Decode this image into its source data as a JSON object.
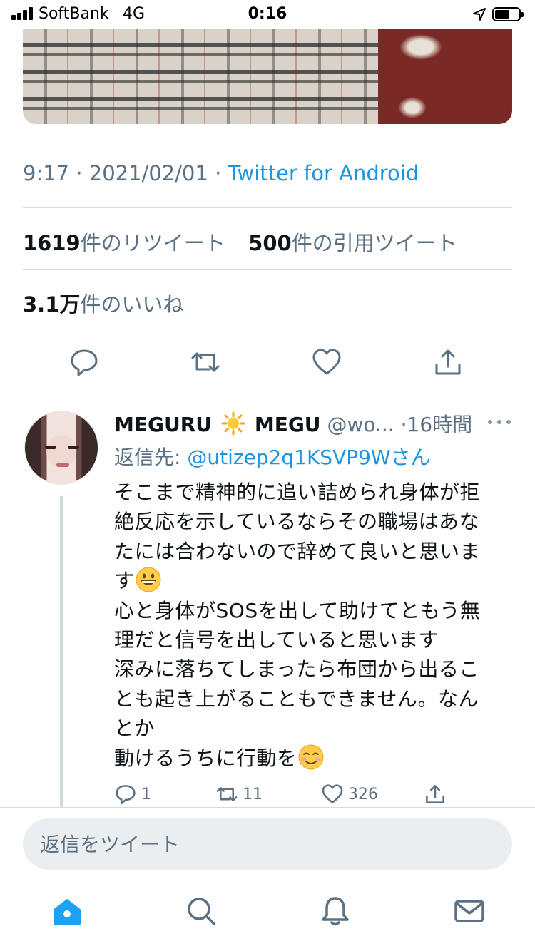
{
  "status_bar": {
    "carrier": "SoftBank",
    "network": "4G",
    "time": "0:16"
  },
  "tweet": {
    "image_icon": "photo-checkered-fabric",
    "time": "9:17",
    "separator": " · ",
    "date": "2021/02/01",
    "source": "Twitter for Android",
    "retweets_count": "1619",
    "retweets_label": "件のリツイート",
    "quotes_count": "500",
    "quotes_label": "件の引用ツイート",
    "likes_count": "3.1万",
    "likes_label": "件のいいね",
    "actions": [
      "reply-icon",
      "retweet-icon",
      "like-icon",
      "share-icon"
    ]
  },
  "reply": {
    "name_part1": "MEGURU",
    "name_emoji": "sun-emoji",
    "name_part2": "MEGU",
    "handle": "@wo...",
    "time": "·16時間",
    "more_icon": "more-dots-icon",
    "reply_to_label": "返信先: ",
    "reply_to_mention": "@utizep2q1KSVP9Wさん",
    "body_lines": [
      "そこまで精神的に追い詰められ身体が拒",
      "絶反応を示しているならその職場はあな",
      "たには合わないので辞めて良いと思いま",
      "す",
      "心と身体がSOSを出して助けてともう無",
      "理だと信号を出していると思います",
      "深みに落ちてしまったら布団から出るこ",
      "とも起き上がることもできません。なん",
      "とか",
      "動けるうちに行動を"
    ],
    "reply_count": "1",
    "retweet_count": "11",
    "like_count": "326"
  },
  "composer": {
    "placeholder": "返信をツイート"
  },
  "tab_bar": {
    "tabs": [
      "home-icon",
      "search-icon",
      "notifications-icon",
      "messages-icon"
    ],
    "active_color": "#1da1f2",
    "inactive_color": "#5b7083"
  }
}
